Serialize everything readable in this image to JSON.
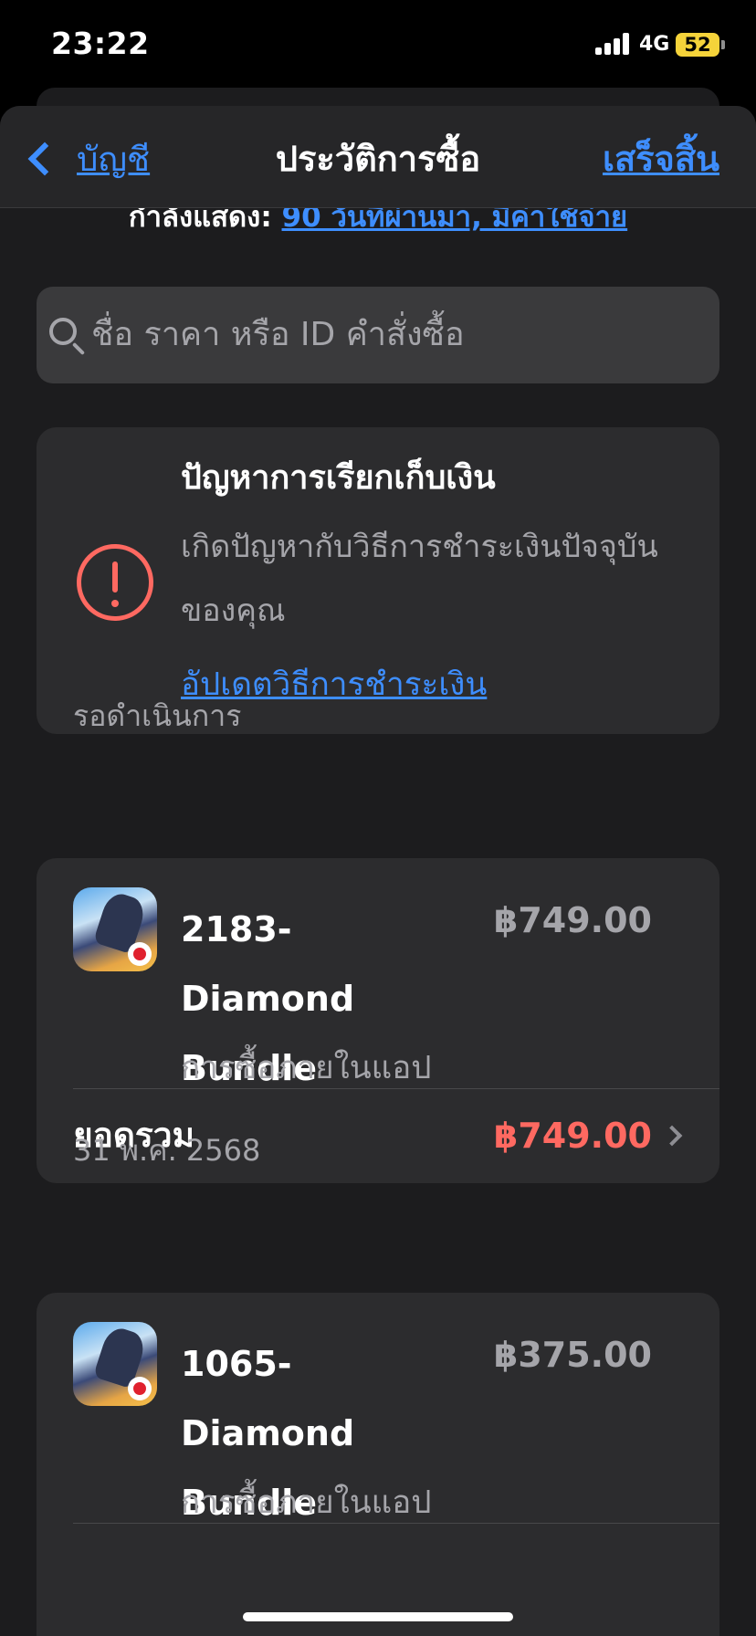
{
  "status_bar": {
    "time": "23:22",
    "network": "4G",
    "battery": "52"
  },
  "nav": {
    "back_label": "บัญชี",
    "title": "ประวัติการซื้อ",
    "done_label": "เสร็จสิ้น"
  },
  "showing": {
    "prefix": "กำลังแสดง: ",
    "link": "90 วันที่ผ่านมา, มีค่าใช้จ่าย"
  },
  "search": {
    "placeholder": "ชื่อ ราคา หรือ ID คำสั่งซื้อ"
  },
  "billing_problem": {
    "title": "ปัญหาการเรียกเก็บเงิน",
    "description": "เกิดปัญหากับวิธีการชำระเงินปัจจุบันของคุณ",
    "link": "อัปเดตวิธีการชำระเงิน"
  },
  "sections": [
    {
      "label": "รอดำเนินการ",
      "item": {
        "name": "2183-Diamond Bundle",
        "price": "฿749.00",
        "type": "การซื้อภายในแอป"
      },
      "total_label": "ยอดรวม",
      "total_amount": "฿749.00"
    },
    {
      "label": "31 พ.ค. 2568",
      "item": {
        "name": "1065-Diamond Bundle",
        "price": "฿375.00",
        "type": "การซื้อภายในแอป"
      }
    }
  ],
  "colors": {
    "accent": "#3e8eff",
    "alert": "#ff6961",
    "background": "#1c1c1e",
    "card": "#2c2c2e"
  }
}
